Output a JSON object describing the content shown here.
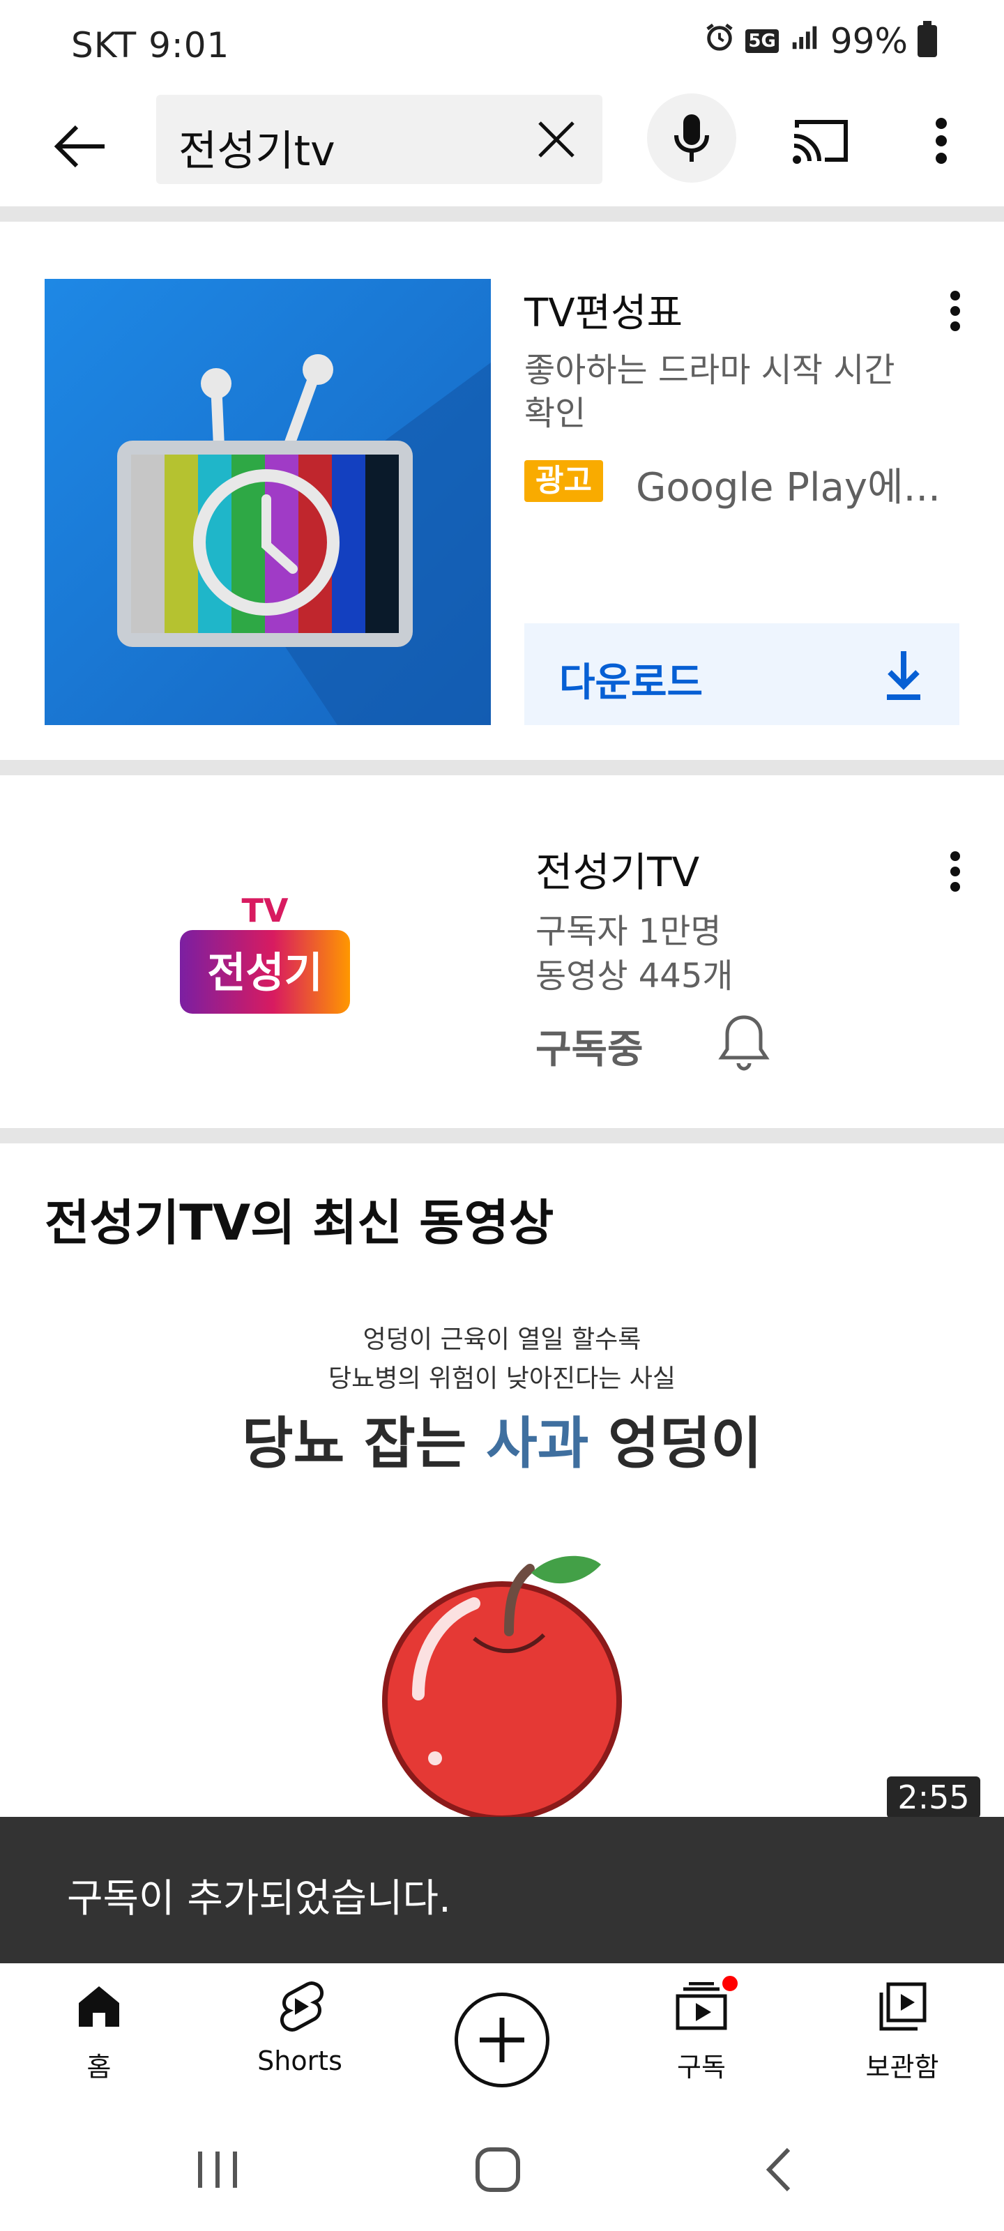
{
  "status_bar": {
    "carrier_time": "SKT  9:01",
    "network": "5G",
    "battery": "99%"
  },
  "search": {
    "query": "전성기tv"
  },
  "ad": {
    "title": "TV편성표",
    "description": "좋아하는 드라마 시작 시간 확인",
    "badge": "광고",
    "source": "Google Play에...",
    "download_label": "다운로드"
  },
  "channel": {
    "name": "전성기TV",
    "subscribers": "구독자 1만명",
    "videos": "동영상 445개",
    "status": "구독중",
    "logo_tv": "TV",
    "logo_text": "전성기"
  },
  "latest": {
    "section_title": "전성기TV의 최신 동영상",
    "thumb_line1": "엉덩이 근육이 열일 할수록",
    "thumb_line2": "당뇨병의 위험이 낮아진다는 사실",
    "thumb_headline_a": "당뇨 잡는 ",
    "thumb_headline_accent": "사과",
    "thumb_headline_b": " 엉덩이",
    "duration": "2:55"
  },
  "snackbar": {
    "message": "구독이 추가되었습니다."
  },
  "bottom_nav": {
    "home": "홈",
    "shorts": "Shorts",
    "subscriptions": "구독",
    "library": "보관함"
  },
  "colors": {
    "ad_badge": "#f9ab00",
    "download_text": "#065fd4",
    "download_bg": "#eef5fe",
    "snackbar": "#333333",
    "notification_dot": "#ff0000"
  }
}
